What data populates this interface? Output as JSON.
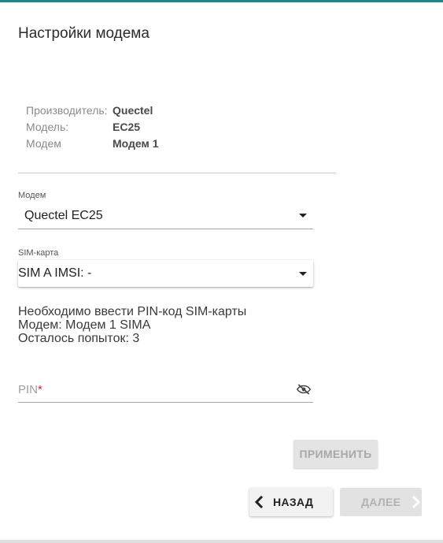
{
  "page": {
    "title": "Настройки модема"
  },
  "device_info": [
    {
      "label": "Производитель:",
      "value": "Quectel"
    },
    {
      "label": "Модель:",
      "value": "EC25"
    },
    {
      "label": "Модем",
      "value": "Модем 1"
    }
  ],
  "modem_select": {
    "label": "Модем",
    "value": "Quectel EC25"
  },
  "sim_select": {
    "label": "SIM-карта",
    "value": "SIM A IMSI: -"
  },
  "pin_message": {
    "line1": "Необходимо ввести PIN-код SIM-карты",
    "line2": "Модем: Модем 1 SIMA",
    "line3": "Осталось попыток: 3"
  },
  "pin_field": {
    "placeholder": "PIN",
    "required_mark": "*",
    "value": ""
  },
  "buttons": {
    "apply": "ПРИМЕНИТЬ",
    "back": "НАЗАД",
    "next": "ДАЛЕЕ"
  },
  "colors": {
    "accent": "#1a8a8e",
    "required": "#d32f2f",
    "disabled_text": "#a8a8a8"
  },
  "icons": {
    "visibility": "eye-off-icon",
    "back": "chevron-left-icon",
    "next": "chevron-right-icon",
    "dropdown": "caret-down-icon"
  }
}
